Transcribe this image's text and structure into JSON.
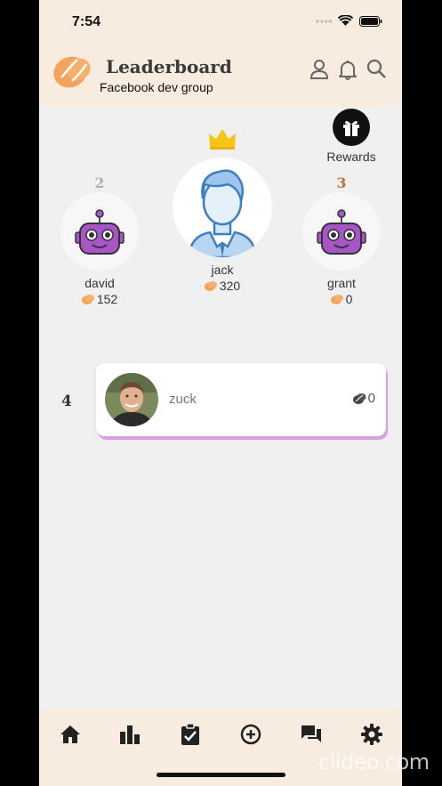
{
  "status": {
    "time": "7:54"
  },
  "header": {
    "title": "Leaderboard",
    "subtitle": "Facebook dev group"
  },
  "rewards": {
    "label": "Rewards"
  },
  "podium": {
    "first": {
      "rank": "",
      "name": "jack",
      "score": "320"
    },
    "second": {
      "rank": "2",
      "name": "david",
      "score": "152"
    },
    "third": {
      "rank": "3",
      "name": "grant",
      "score": "0"
    }
  },
  "list": [
    {
      "rank": "4",
      "name": "zuck",
      "score": "0"
    }
  ],
  "colors": {
    "header_bg": "#f8ece0",
    "bean": "#f2a45a",
    "robot": "#a855c8",
    "accent_shadow": "#d8a0dd",
    "crown": "#f5c518",
    "bronze": "#c0703a",
    "silver": "#b0b0b0"
  },
  "watermark": "clideo.com"
}
